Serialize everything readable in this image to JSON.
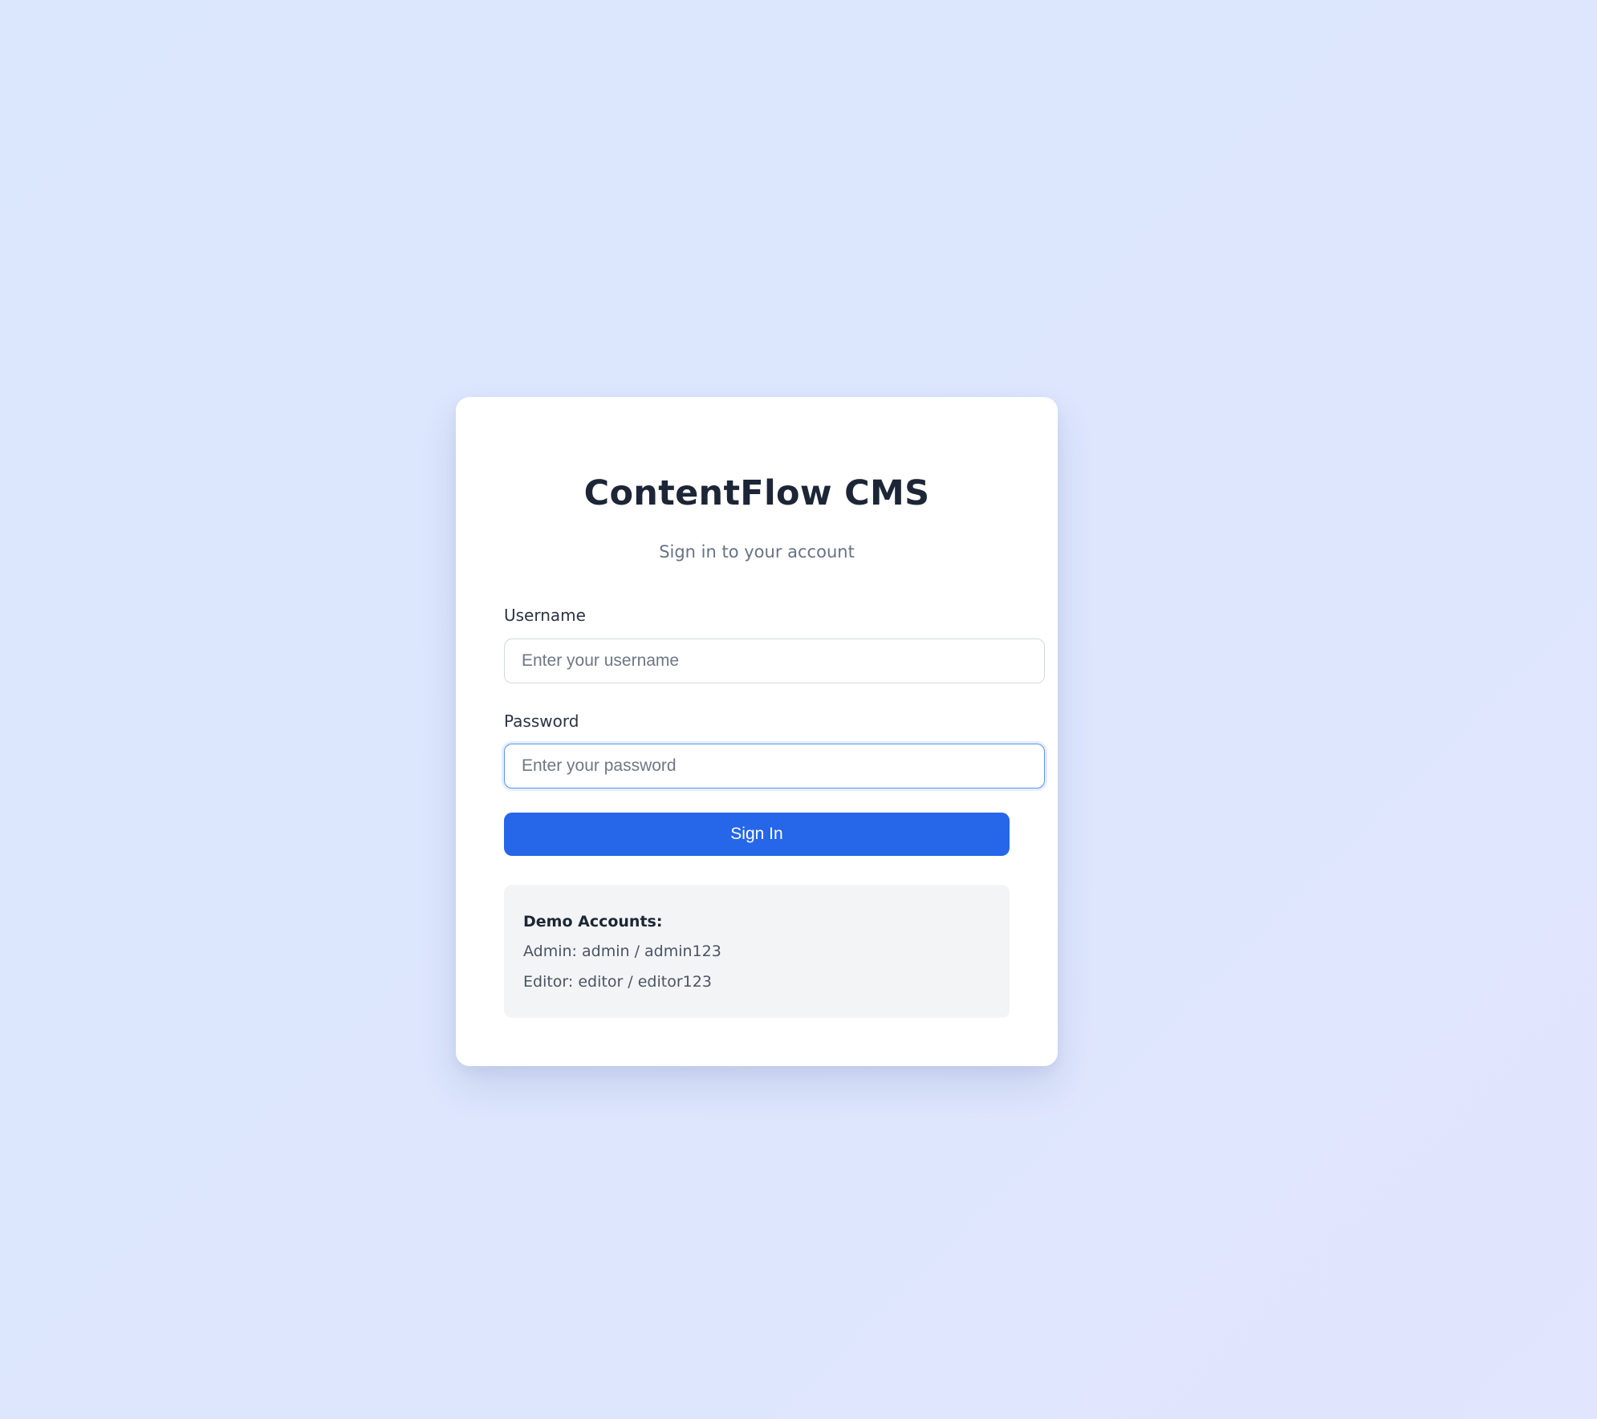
{
  "app": {
    "title": "ContentFlow CMS",
    "subtitle": "Sign in to your account"
  },
  "form": {
    "username": {
      "label": "Username",
      "value": "",
      "placeholder": "Enter your username"
    },
    "password": {
      "label": "Password",
      "value": "",
      "placeholder": "Enter your password"
    },
    "submit_label": "Sign In"
  },
  "demo": {
    "title": "Demo Accounts:",
    "admin": "Admin: admin / admin123",
    "editor": "Editor: editor / editor123"
  },
  "colors": {
    "background": "#dce7fd",
    "card": "#ffffff",
    "primary": "#2666e9",
    "focus_border": "#5e95ec",
    "demo_box": "#f3f4f6"
  }
}
